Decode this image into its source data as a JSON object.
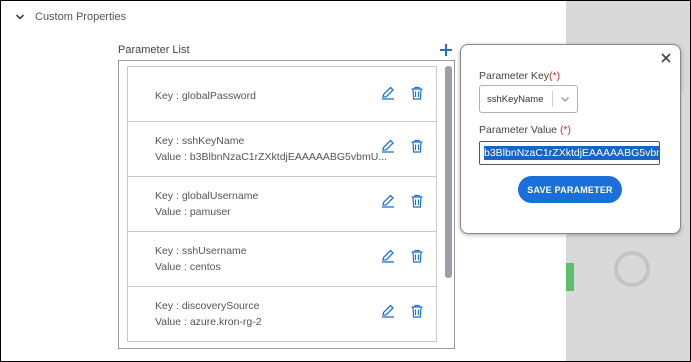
{
  "section": {
    "title": "Custom Properties",
    "icon": "chevron-down-icon"
  },
  "parameter_list": {
    "label": "Parameter List",
    "add_icon": "plus-icon",
    "items": [
      {
        "key": "Key : globalPassword",
        "value": ""
      },
      {
        "key": "Key : sshKeyName",
        "value": "Value : b3BlbnNzaC1rZXktdjEAAAAABG5vbmU..."
      },
      {
        "key": "Key : globalUsername",
        "value": "Value : pamuser"
      },
      {
        "key": "Key : sshUsername",
        "value": "Value : centos"
      },
      {
        "key": "Key : discoverySource",
        "value": "Value : azure.kron-rg-2"
      }
    ],
    "edit_icon": "pencil-icon",
    "delete_icon": "trash-icon"
  },
  "popup": {
    "close_icon": "close-icon",
    "key_label": "Parameter Key",
    "key_required": "(*)",
    "key_selected": "sshKeyName",
    "value_label": "Parameter Value ",
    "value_required": "(*)",
    "value_text": "b3BlbnNzaC1rZXktdjEAAAAABG5vbmU",
    "save_label": "SAVE PARAMETER"
  },
  "colors": {
    "accent": "#1a6fd8",
    "required": "#e0222a",
    "selection": "#1a64c6"
  }
}
